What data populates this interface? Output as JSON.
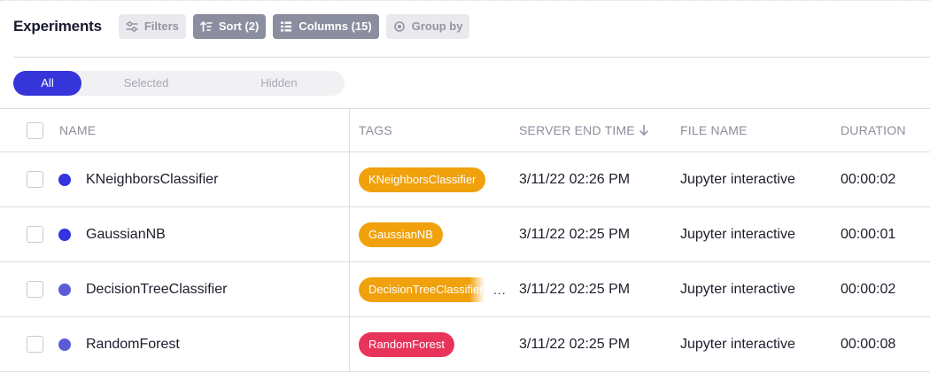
{
  "header": {
    "title": "Experiments",
    "filters_label": "Filters",
    "sort_label": "Sort (2)",
    "columns_label": "Columns (15)",
    "groupby_label": "Group by"
  },
  "view_toggle": {
    "options": [
      "All",
      "Selected",
      "Hidden"
    ],
    "active": "All"
  },
  "table": {
    "columns": [
      "NAME",
      "TAGS",
      "SERVER END TIME",
      "FILE NAME",
      "DURATION"
    ],
    "sorted_column": "SERVER END TIME",
    "sort_direction": "descending",
    "rows": [
      {
        "name": "KNeighborsClassifier",
        "dot_color": "#3333e0",
        "tag": "KNeighborsClassifier",
        "tag_color": "#f0a10c",
        "end_time": "3/11/22 02:26 PM",
        "file_name": "Jupyter interactive",
        "duration": "00:00:02"
      },
      {
        "name": "GaussianNB",
        "dot_color": "#3333e0",
        "tag": "GaussianNB",
        "tag_color": "#f0a10c",
        "end_time": "3/11/22 02:25 PM",
        "file_name": "Jupyter interactive",
        "duration": "00:00:01"
      },
      {
        "name": "DecisionTreeClassifier",
        "dot_color": "#5c5cd8",
        "tag": "DecisionTreeClassifier",
        "tag_color": "#f0a10c",
        "tag_more": "...",
        "end_time": "3/11/22 02:25 PM",
        "file_name": "Jupyter interactive",
        "duration": "00:00:02"
      },
      {
        "name": "RandomForest",
        "dot_color": "#5c5cd8",
        "tag": "RandomForest",
        "tag_color": "#e8335a",
        "end_time": "3/11/22 02:25 PM",
        "file_name": "Jupyter interactive",
        "duration": "00:00:08"
      }
    ]
  },
  "colors": {
    "accent": "#3535d9",
    "button_dark": "#8b8e9f",
    "button_light": "#eaeaee"
  }
}
